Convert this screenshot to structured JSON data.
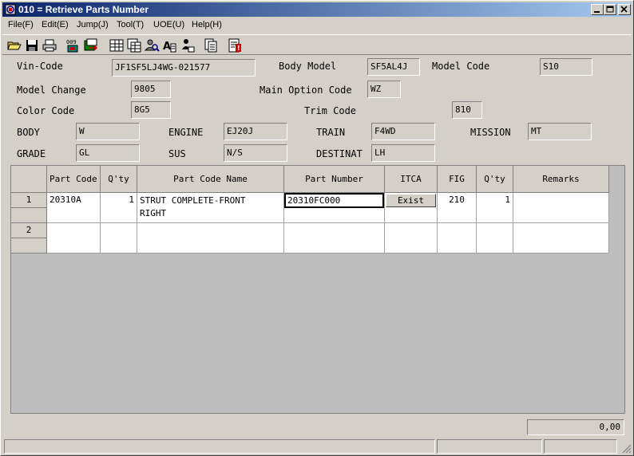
{
  "window": {
    "title": "010 = Retrieve Parts Number"
  },
  "menu": [
    {
      "label": "File(F)"
    },
    {
      "label": "Edit(E)"
    },
    {
      "label": "Jump(J)"
    },
    {
      "label": "Tool(T)"
    },
    {
      "label": "UOE(U)"
    },
    {
      "label": "Help(H)"
    }
  ],
  "form": {
    "vin_code": {
      "label": "Vin-Code",
      "value": "JF1SF5LJ4WG-021577"
    },
    "body_model": {
      "label": "Body Model",
      "value": "SF5AL4J"
    },
    "model_code": {
      "label": "Model Code",
      "value": "S10"
    },
    "model_change": {
      "label": "Model Change",
      "value": "9805"
    },
    "main_option_code": {
      "label": "Main Option Code",
      "value": "WZ"
    },
    "color_code": {
      "label": "Color Code",
      "value": "8G5"
    },
    "trim_code": {
      "label": "Trim Code",
      "value": "810"
    },
    "body": {
      "label": "BODY",
      "value": "W"
    },
    "engine": {
      "label": "ENGINE",
      "value": "EJ20J"
    },
    "train": {
      "label": "TRAIN",
      "value": "F4WD"
    },
    "mission": {
      "label": "MISSION",
      "value": "MT"
    },
    "grade": {
      "label": "GRADE",
      "value": "GL"
    },
    "sus": {
      "label": "SUS",
      "value": "N/S"
    },
    "destinat": {
      "label": "DESTINAT",
      "value": "LH"
    }
  },
  "grid": {
    "headers": {
      "part_code": "Part Code",
      "qty1": "Q'ty",
      "part_code_name": "Part Code Name",
      "part_number": "Part Number",
      "itca": "ITCA",
      "fig": "FIG",
      "qty2": "Q'ty",
      "remarks": "Remarks"
    },
    "rows": [
      {
        "num": "1",
        "part_code": "20310A",
        "qty1": "1",
        "name_line1": "STRUT COMPLETE-FRONT",
        "name_line2": "RIGHT",
        "part_number": "20310FC000",
        "itca": "Exist",
        "fig": "210",
        "qty2": "1",
        "remarks": ""
      },
      {
        "num": "2",
        "part_code": "",
        "qty1": "",
        "name_line1": "",
        "name_line2": "",
        "part_number": "",
        "itca": "",
        "fig": "",
        "qty2": "",
        "remarks": ""
      }
    ]
  },
  "total": "0,00",
  "toolbar": {
    "icons": [
      "open-folder-icon",
      "save-icon",
      "print-icon",
      "vin-search-icon",
      "export-icon",
      "table-icon",
      "copy-table-icon",
      "user-search-icon",
      "text-search-icon",
      "person-list-icon",
      "document-copy-icon",
      "document-alert-icon"
    ]
  }
}
